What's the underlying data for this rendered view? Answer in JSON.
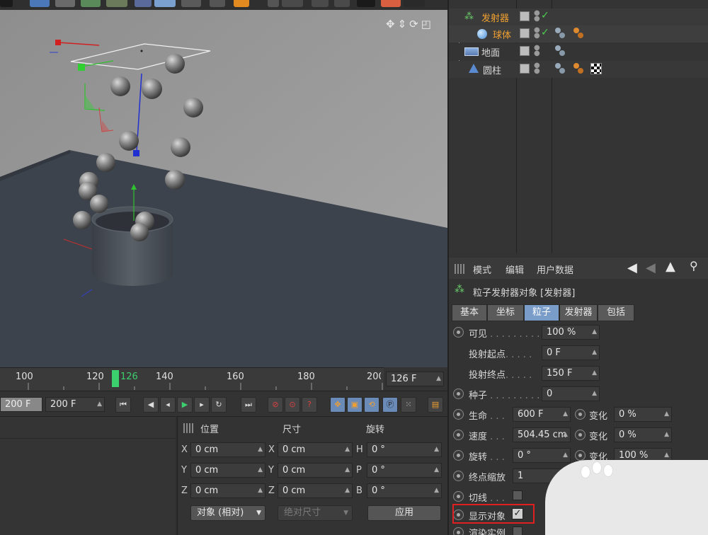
{
  "viewport": {
    "nav_icons": [
      "move-view-icon",
      "pan-view-icon",
      "rotate-view-icon",
      "maximize-view-icon"
    ]
  },
  "scene": {
    "items": [
      {
        "name": "发射器",
        "color": "#f0a030"
      },
      {
        "name": "球体",
        "color": "#f0a030"
      },
      {
        "name": "地面",
        "color": "#d8d8d8"
      },
      {
        "name": "圆柱",
        "color": "#d8d8d8"
      }
    ]
  },
  "attr": {
    "menu": [
      "模式",
      "编辑",
      "用户数据"
    ],
    "object_title": "粒子发射器对象 [发射器]",
    "tabs": [
      "基本",
      "坐标",
      "粒子",
      "发射器",
      "包括"
    ],
    "active_tab": "粒子",
    "rows": {
      "visible": {
        "label": "可见",
        "dots": " . . . . . . . . .",
        "value": "100 %"
      },
      "emit_start": {
        "label": "投射起点",
        "dots": ". . . . .",
        "value": "0 F"
      },
      "emit_end": {
        "label": "投射终点",
        "dots": ". . . . .",
        "value": "150 F"
      },
      "seed": {
        "label": "种子",
        "dots": " . . . . . . . . .",
        "value": "0"
      },
      "lifetime": {
        "label": "生命",
        "dots": " . . .",
        "value": "600 F",
        "var_label": "变化",
        "var_value": "0 %"
      },
      "speed": {
        "label": "速度",
        "dots": " . . .",
        "value": "504.45 cm",
        "var_label": "变化",
        "var_value": "0 %"
      },
      "rotation": {
        "label": "旋转",
        "dots": " . . .",
        "value": "0 °",
        "var_label": "变化",
        "var_value": "100 %"
      },
      "end_scale": {
        "label": "终点缩放",
        "value": "1",
        "var_value": "%"
      },
      "tangential": {
        "label": "切线",
        "dots": " . . ."
      },
      "show_objects": {
        "label": "显示对象"
      },
      "render_instances": {
        "label": "渲染实例"
      }
    },
    "highlight_color": "#e02020"
  },
  "timeline": {
    "ticks": [
      "100",
      "120",
      "126",
      "140",
      "160",
      "180",
      "200"
    ],
    "current": "126",
    "current_field": "126 F"
  },
  "playback": {
    "min_field": "200 F",
    "max_field": "200 F"
  },
  "coords": {
    "headers": [
      "位置",
      "尺寸",
      "旋转"
    ],
    "rows": [
      {
        "pos_axis": "X",
        "pos": "0 cm",
        "size_axis": "X",
        "size": "0 cm",
        "rot_axis": "H",
        "rot": "0 °"
      },
      {
        "pos_axis": "Y",
        "pos": "0 cm",
        "size_axis": "Y",
        "size": "0 cm",
        "rot_axis": "P",
        "rot": "0 °"
      },
      {
        "pos_axis": "Z",
        "pos": "0 cm",
        "size_axis": "Z",
        "size": "0 cm",
        "rot_axis": "B",
        "rot": "0 °"
      }
    ],
    "mode_select": "对象 (相对)",
    "size_select": "绝对尺寸",
    "apply_label": "应用"
  },
  "colors": {
    "accent": "#7a9cc8",
    "playhead": "#3ccf6e",
    "highlight": "#e02020"
  }
}
